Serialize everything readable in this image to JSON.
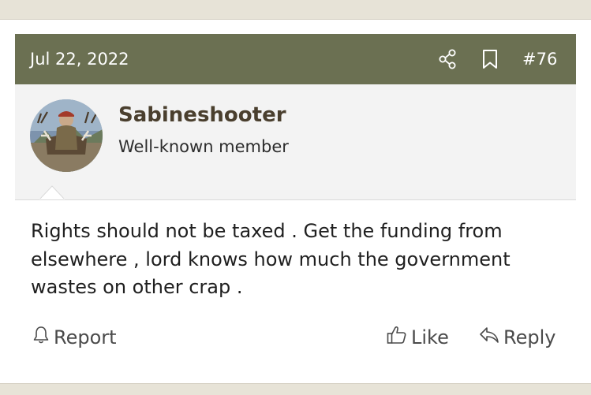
{
  "post": {
    "date": "Jul 22, 2022",
    "number": "#76",
    "header_color": "#6b7052"
  },
  "author": {
    "username": "Sabineshooter",
    "title": "Well-known member",
    "username_color": "#4a3f2e"
  },
  "message": {
    "text": "Rights should not be taxed . Get the funding from elsewhere , lord knows how much the government wastes on other crap ."
  },
  "actions": {
    "report_label": "Report",
    "like_label": "Like",
    "reply_label": "Reply"
  },
  "icons": {
    "share": "share-icon",
    "bookmark": "bookmark-icon",
    "report": "bell-icon",
    "like": "thumbs-up-icon",
    "reply": "reply-arrow-icon"
  }
}
